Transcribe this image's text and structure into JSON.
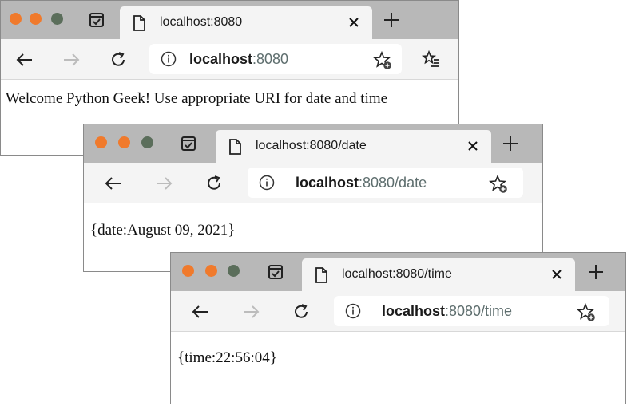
{
  "colors": {
    "traffic_red": "#f07a2c",
    "traffic_yellow": "#f07a2c",
    "traffic_green": "#5b6e5b",
    "tabbar_bg": "#b8b8b8",
    "toolbar_bg": "#f4f4f4",
    "url_rest": "#5e6e6e"
  },
  "windows": [
    {
      "tab_title": "localhost:8080",
      "url_host": "localhost",
      "url_rest": ":8080",
      "body_text": "Welcome Python Geek! Use appropriate URI for date and time"
    },
    {
      "tab_title": "localhost:8080/date",
      "url_host": "localhost",
      "url_rest": ":8080/date",
      "body_text": "{date:August 09, 2021}"
    },
    {
      "tab_title": "localhost:8080/time",
      "url_host": "localhost",
      "url_rest": ":8080/time",
      "body_text": "{time:22:56:04}"
    }
  ],
  "icons": {
    "close": "close-icon",
    "back": "back-arrow-icon",
    "forward": "forward-arrow-icon",
    "reload": "reload-icon",
    "info": "info-icon",
    "bookmark": "bookmark-star-icon",
    "new_tab": "plus-icon",
    "page": "page-icon",
    "tabs": "tab-overview-icon",
    "menu": "bookmarks-menu-icon"
  }
}
